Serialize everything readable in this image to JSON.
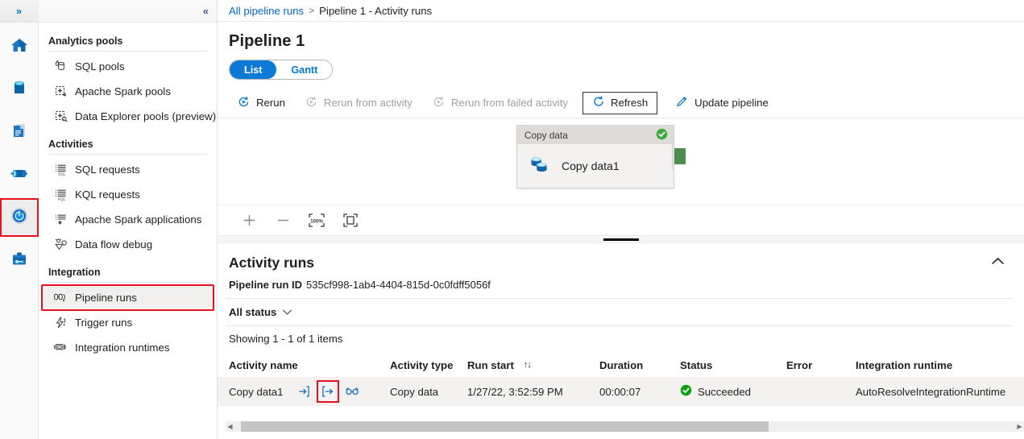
{
  "rail": {
    "expand_label": "»",
    "items": [
      {
        "name": "home",
        "icon": "home-icon",
        "active": false
      },
      {
        "name": "data",
        "icon": "data-icon",
        "active": false
      },
      {
        "name": "develop",
        "icon": "develop-icon",
        "active": false
      },
      {
        "name": "integrate",
        "icon": "integrate-icon",
        "active": false
      },
      {
        "name": "monitor",
        "icon": "monitor-icon",
        "active": true
      },
      {
        "name": "manage",
        "icon": "manage-icon",
        "active": false
      }
    ]
  },
  "sidebar": {
    "collapse_label": "«",
    "groups": [
      {
        "title": "Analytics pools",
        "items": [
          {
            "label": "SQL pools",
            "icon": "sql-pool-icon"
          },
          {
            "label": "Apache Spark pools",
            "icon": "spark-pool-icon"
          },
          {
            "label": "Data Explorer pools (preview)",
            "icon": "data-explorer-pool-icon"
          }
        ]
      },
      {
        "title": "Activities",
        "items": [
          {
            "label": "SQL requests",
            "icon": "sql-requests-icon"
          },
          {
            "label": "KQL requests",
            "icon": "kql-requests-icon"
          },
          {
            "label": "Apache Spark applications",
            "icon": "spark-applications-icon"
          },
          {
            "label": "Data flow debug",
            "icon": "data-flow-debug-icon"
          }
        ]
      },
      {
        "title": "Integration",
        "items": [
          {
            "label": "Pipeline runs",
            "icon": "pipeline-runs-icon",
            "selected": true,
            "highlighted": true
          },
          {
            "label": "Trigger runs",
            "icon": "trigger-runs-icon"
          },
          {
            "label": "Integration runtimes",
            "icon": "integration-runtimes-icon"
          }
        ]
      }
    ]
  },
  "breadcrumb": {
    "root": "All pipeline runs",
    "separator": ">",
    "current": "Pipeline 1 - Activity runs"
  },
  "page": {
    "title": "Pipeline 1"
  },
  "pivot": {
    "list": "List",
    "gantt": "Gantt",
    "selected": "List"
  },
  "toolbar": {
    "rerun": "Rerun",
    "rerun_from_activity": "Rerun from activity",
    "rerun_from_failed_activity": "Rerun from failed activity",
    "refresh": "Refresh",
    "update_pipeline": "Update pipeline"
  },
  "canvas": {
    "node": {
      "type_label": "Copy data",
      "name": "Copy data1",
      "status": "succeeded"
    },
    "controls": {
      "zoom_in": "+",
      "zoom_out": "−",
      "zoom_level": "100%",
      "fit_to_screen": "Fit to screen"
    }
  },
  "activity_runs": {
    "title": "Activity runs",
    "run_id_label": "Pipeline run ID",
    "run_id_value": "535cf998-1ab4-4404-815d-0c0fdff5056f",
    "status_filter": "All status",
    "showing": "Showing 1 - 1 of 1 items",
    "columns": [
      "Activity name",
      "Activity type",
      "Run start",
      "Duration",
      "Status",
      "Error",
      "Integration runtime"
    ],
    "sort_column": "Run start",
    "rows": [
      {
        "activity_name": "Copy data1",
        "activity_type": "Copy data",
        "run_start": "1/27/22, 3:52:59 PM",
        "duration": "00:00:07",
        "status": "Succeeded",
        "error": "",
        "integration_runtime": "AutoResolveIntegrationRuntime",
        "actions": [
          {
            "name": "input-icon",
            "highlighted": false
          },
          {
            "name": "output-icon",
            "highlighted": true
          },
          {
            "name": "details-glasses-icon",
            "highlighted": false
          }
        ]
      }
    ]
  },
  "colors": {
    "accent": "#0078d4",
    "link": "#0066cc",
    "success": "#107c10",
    "highlight_outline": "#e81123",
    "row_bg": "#f3f2f1"
  }
}
